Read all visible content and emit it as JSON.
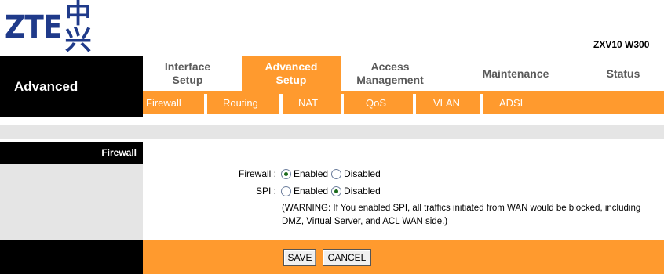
{
  "brand": {
    "logo_text": "ZTE",
    "logo_cn": "中兴",
    "model": "ZXV10 W300"
  },
  "nav": {
    "section_title": "Advanced",
    "tabs": [
      {
        "label_line1": "Interface",
        "label_line2": "Setup",
        "active": false
      },
      {
        "label_line1": "Advanced",
        "label_line2": "Setup",
        "active": true
      },
      {
        "label_line1": "Access",
        "label_line2": "Management",
        "active": false
      },
      {
        "label_line1": "Maintenance",
        "label_line2": "",
        "active": false
      },
      {
        "label_line1": "Status",
        "label_line2": "",
        "active": false
      }
    ],
    "subtabs": [
      "Firewall",
      "Routing",
      "NAT",
      "QoS",
      "VLAN",
      "ADSL"
    ]
  },
  "section": {
    "label": "Firewall"
  },
  "form": {
    "firewall": {
      "label": "Firewall :",
      "options": [
        "Enabled",
        "Disabled"
      ],
      "selected": "Enabled"
    },
    "spi": {
      "label": "SPI :",
      "options": [
        "Enabled",
        "Disabled"
      ],
      "selected": "Disabled"
    },
    "warning": "(WARNING: If You enabled SPI, all traffics initiated from WAN would be blocked, including DMZ, Virtual Server, and ACL WAN side.)"
  },
  "buttons": {
    "save": "SAVE",
    "cancel": "CANCEL"
  },
  "colors": {
    "accent": "#ff9a2e",
    "dark": "#000000",
    "panel": "#e5e5e5",
    "logo": "#1f3a8a"
  }
}
